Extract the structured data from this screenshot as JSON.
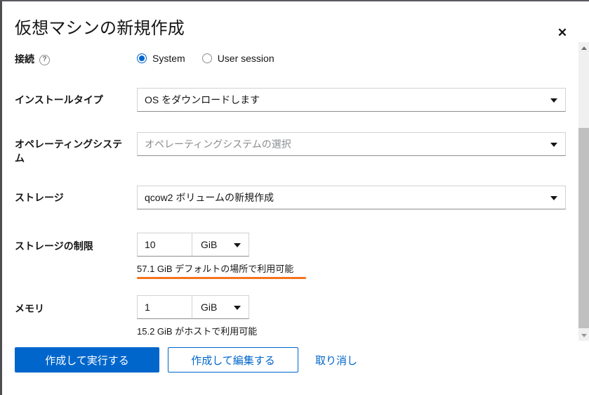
{
  "dialog": {
    "title": "仮想マシンの新規作成",
    "close_label": "✕",
    "close_icon": "close-icon"
  },
  "form": {
    "connection": {
      "label": "接続",
      "help_icon": "?",
      "options": [
        {
          "label": "System",
          "selected": true
        },
        {
          "label": "User session",
          "selected": false
        }
      ]
    },
    "install_type": {
      "label": "インストールタイプ",
      "value": "OS をダウンロードします",
      "caret_icon": "chevron-down-icon"
    },
    "operating_system": {
      "label": "オペレーティングシステム",
      "placeholder": "オペレーティングシステムの選択",
      "value": "オペレーティングシステムの選択",
      "caret_icon": "chevron-down-icon"
    },
    "storage": {
      "label": "ストレージ",
      "value": "qcow2 ボリュームの新規作成",
      "caret_icon": "chevron-down-icon"
    },
    "storage_limit": {
      "label": "ストレージの制限",
      "value": "10",
      "unit": "GiB",
      "hint": "57.1 GiB デフォルトの場所で利用可能",
      "caret_icon": "chevron-down-icon"
    },
    "memory": {
      "label": "メモリ",
      "value": "1",
      "unit": "GiB",
      "hint": "15.2 GiB がホストで利用可能",
      "caret_icon": "chevron-down-icon"
    }
  },
  "footer": {
    "create_and_run": "作成して実行する",
    "create_and_edit": "作成して編集する",
    "cancel": "取り消し"
  },
  "scrollbar": {
    "up_icon": "scroll-up-arrow-icon",
    "down_icon": "scroll-down-arrow-icon"
  },
  "colors": {
    "accent": "#0066cc",
    "highlight_underline": "#f4731c",
    "placeholder_text": "#8a8d90"
  }
}
